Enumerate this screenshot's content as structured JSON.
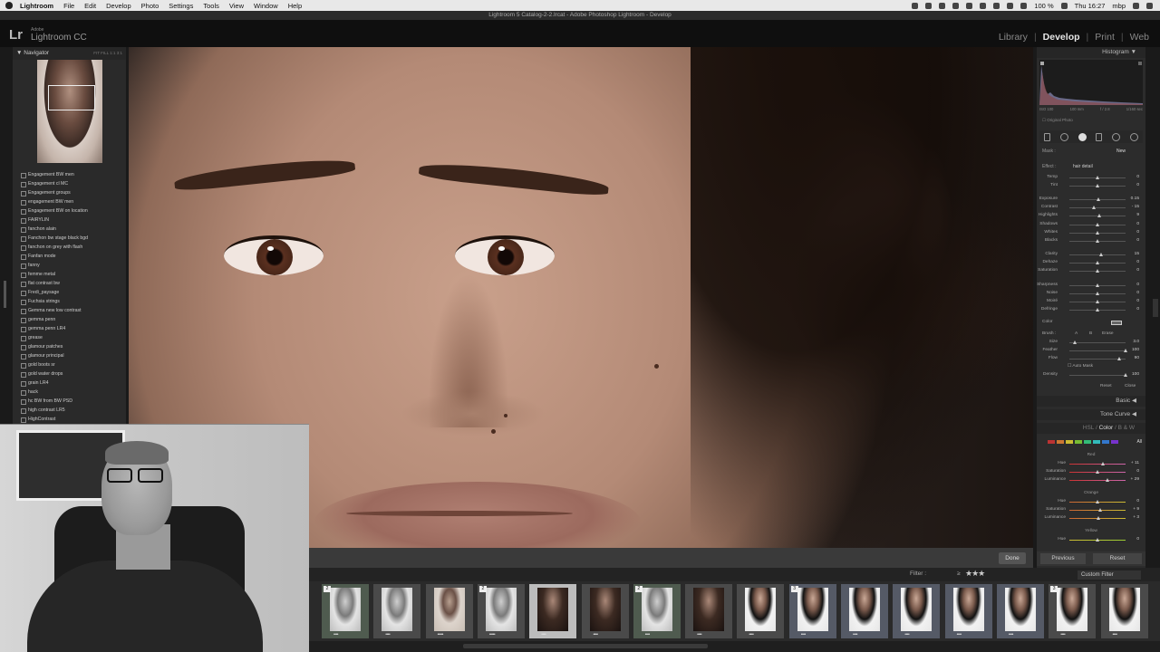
{
  "menubar": {
    "items": [
      "Lightroom",
      "File",
      "Edit",
      "Develop",
      "Photo",
      "Settings",
      "Tools",
      "View",
      "Window",
      "Help"
    ],
    "battery": "100 %",
    "clock": "Thu 16:27",
    "user": "mbp"
  },
  "window": {
    "title": "Lightroom 5 Catalog-2-2.lrcat - Adobe Photoshop Lightroom - Develop"
  },
  "identity": {
    "logo": "Lr",
    "adobe": "Adobe",
    "name": "Lightroom CC"
  },
  "modules": [
    "Library",
    "Develop",
    "Print",
    "Web"
  ],
  "left_panel": {
    "navigator_title": "Navigator",
    "navigator_options": "FIT  FILL  1:1  3:1",
    "collections": [
      "Engagement BW men",
      "Engagement cl MC",
      "Engagement groups",
      "engagement BW men",
      "Engagement BW on location",
      "FAIRYLIN",
      "fanchon alain",
      "Fanchon bw stage black bgd",
      "fanchon on grey with flash",
      "Fanfan mode",
      "fanny",
      "femme metal",
      "flat contrast bw",
      "Fredi_paysage",
      "Fuchsia strings",
      "Gemma new low contrast",
      "gemma penn",
      "gemma penn LR4",
      "grease",
      "glamour patches",
      "glamour principal",
      "gold boots sr",
      "gold water drops",
      "grain LR4",
      "hack",
      "hc BW from BW PSD",
      "high contrast LR5",
      "HighContrast"
    ]
  },
  "right_panel": {
    "histogram_title": "Histogram",
    "hist_info": [
      "ISO 100",
      "100 mm",
      "f / 2.8",
      "1/160 sec"
    ],
    "original_photo": "Original Photo",
    "mask_label": "Mask :",
    "mask_new": "New",
    "effect_label": "Effect :",
    "effect_value": "hair detail",
    "sliders_wb": [
      {
        "label": "Temp",
        "value": "0",
        "pos": 0.5
      },
      {
        "label": "Tint",
        "value": "0",
        "pos": 0.5
      }
    ],
    "sliders_tone": [
      {
        "label": "Exposure",
        "value": "0.15",
        "pos": 0.52
      },
      {
        "label": "Contrast",
        "value": "- 15",
        "pos": 0.44
      },
      {
        "label": "Highlights",
        "value": "9",
        "pos": 0.54
      },
      {
        "label": "Shadows",
        "value": "0",
        "pos": 0.5
      },
      {
        "label": "Whites",
        "value": "0",
        "pos": 0.5
      },
      {
        "label": "Blacks",
        "value": "0",
        "pos": 0.5
      }
    ],
    "sliders_presence": [
      {
        "label": "Clarity",
        "value": "15",
        "pos": 0.57
      },
      {
        "label": "Dehaze",
        "value": "0",
        "pos": 0.5
      },
      {
        "label": "Saturation",
        "value": "0",
        "pos": 0.5
      }
    ],
    "sliders_detail": [
      {
        "label": "Sharpness",
        "value": "0",
        "pos": 0.5
      },
      {
        "label": "Noise",
        "value": "0",
        "pos": 0.5
      },
      {
        "label": "Moiré",
        "value": "0",
        "pos": 0.5
      },
      {
        "label": "Defringe",
        "value": "0",
        "pos": 0.5
      }
    ],
    "color_label": "Color",
    "brush_label": "Brush :",
    "brush_a": "A",
    "brush_b": "B",
    "brush_erase": "Erase",
    "sliders_brush": [
      {
        "label": "Size",
        "value": "3.0",
        "pos": 0.1
      },
      {
        "label": "Feather",
        "value": "100",
        "pos": 1.0
      },
      {
        "label": "Flow",
        "value": "90",
        "pos": 0.9
      }
    ],
    "auto_mask": "Auto Mask",
    "sliders_density": [
      {
        "label": "Density",
        "value": "100",
        "pos": 1.0
      }
    ],
    "reset": "Reset",
    "close": "Close",
    "basic": "Basic",
    "tone_curve": "Tone Curve",
    "hsl_tabs": [
      "HSL",
      "Color",
      "B & W"
    ],
    "hsl_all": "All",
    "swatch_colors": [
      "#b33",
      "#c73",
      "#cb3",
      "#7b3",
      "#3b7",
      "#3bb",
      "#37c",
      "#73c"
    ],
    "red_title": "Red",
    "red_sliders": [
      {
        "label": "Hue",
        "value": "+ 11",
        "pos": 0.6
      },
      {
        "label": "Saturation",
        "value": "0",
        "pos": 0.5
      },
      {
        "label": "Luminance",
        "value": "+ 29",
        "pos": 0.68
      }
    ],
    "orange_title": "Orange",
    "orange_sliders": [
      {
        "label": "Hue",
        "value": "0",
        "pos": 0.5
      },
      {
        "label": "Saturation",
        "value": "+ 9",
        "pos": 0.56
      },
      {
        "label": "Luminance",
        "value": "+ 3",
        "pos": 0.52
      }
    ],
    "yellow_title": "Yellow",
    "yellow_sliders": [
      {
        "label": "Hue",
        "value": "0",
        "pos": 0.5
      }
    ],
    "previous": "Previous",
    "reset_btn": "Reset"
  },
  "toolbar": {
    "done": "Done"
  },
  "filterbar": {
    "label": "Filter :",
    "ge": "≥",
    "stars": "★★★",
    "custom_filter": "Custom Filter"
  },
  "filmstrip": [
    {
      "style": "bw",
      "bg": "green",
      "badge": "2",
      "dots": "••••"
    },
    {
      "style": "bw",
      "bg": "gray",
      "badge": "",
      "dots": "••••"
    },
    {
      "style": "light",
      "bg": "gray",
      "badge": "",
      "dots": "•••••"
    },
    {
      "style": "bw",
      "bg": "gray",
      "badge": "2",
      "dots": "•••••"
    },
    {
      "style": "dark",
      "bg": "sel",
      "badge": "",
      "dots": "••••"
    },
    {
      "style": "dark",
      "bg": "gray",
      "badge": "",
      "dots": "••••"
    },
    {
      "style": "bw",
      "bg": "green",
      "badge": "2",
      "dots": "••••"
    },
    {
      "style": "dark",
      "bg": "gray",
      "badge": "",
      "dots": "••••"
    },
    {
      "style": "blk",
      "bg": "gray",
      "badge": "",
      "dots": "••••"
    },
    {
      "style": "blk",
      "bg": "blue",
      "badge": "3",
      "dots": "••••"
    },
    {
      "style": "blk",
      "bg": "blue",
      "badge": "",
      "dots": "••••"
    },
    {
      "style": "blk",
      "bg": "blue",
      "badge": "",
      "dots": "••••"
    },
    {
      "style": "blk",
      "bg": "blue",
      "badge": "",
      "dots": "••••"
    },
    {
      "style": "blk",
      "bg": "blue",
      "badge": "",
      "dots": "••••"
    },
    {
      "style": "blk",
      "bg": "gray",
      "badge": "3",
      "dots": "••••"
    },
    {
      "style": "blk",
      "bg": "gray",
      "badge": "",
      "dots": "••••"
    }
  ]
}
